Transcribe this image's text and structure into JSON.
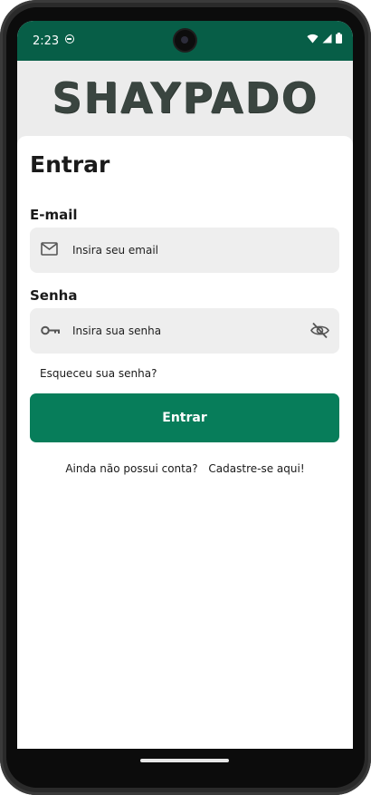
{
  "status_bar": {
    "time": "2:23",
    "icons": [
      "app-notification-icon",
      "wifi-icon",
      "signal-icon",
      "battery-icon"
    ]
  },
  "header": {
    "logo_text": "SHAYPADO"
  },
  "login": {
    "title": "Entrar",
    "email": {
      "label": "E-mail",
      "placeholder": "Insira seu email",
      "value": "",
      "icon": "mail-icon"
    },
    "password": {
      "label": "Senha",
      "placeholder": "Insira sua senha",
      "value": "",
      "icon": "key-icon",
      "toggle_icon": "eye-off-icon"
    },
    "forgot_password": "Esqueceu sua senha?",
    "submit_label": "Entrar",
    "no_account_text": "Ainda não possui conta?",
    "signup_link": "Cadastre-se aqui!"
  },
  "colors": {
    "status_bar": "#075e47",
    "primary_button": "#077d5a",
    "header_bg": "#ececec",
    "input_bg": "#eeeeee",
    "logo": "#3a4540"
  }
}
